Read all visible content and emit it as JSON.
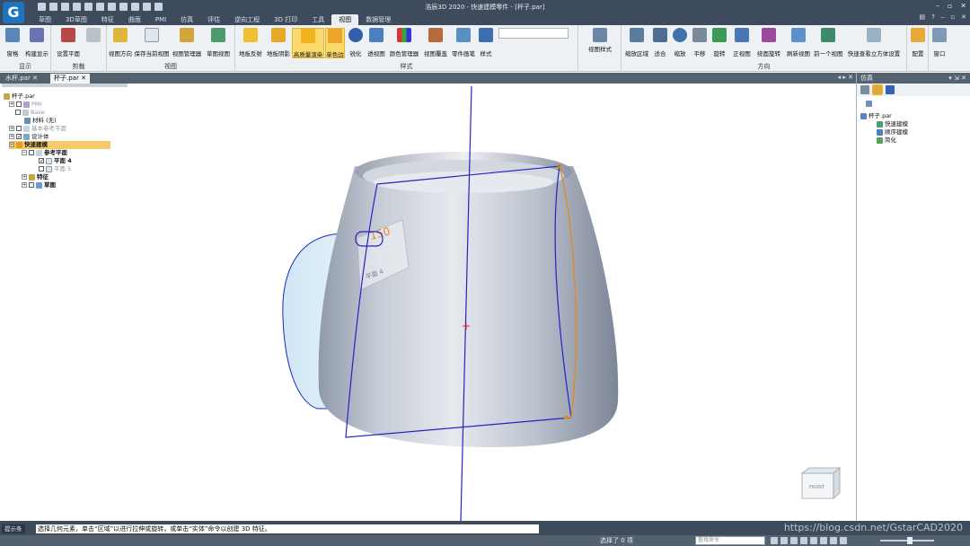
{
  "app": {
    "window_title": "浩辰3D 2020 - 快速建模零件 - [杯子.par]",
    "logo_letter": "G"
  },
  "menu_tabs": [
    "草图",
    "3D草图",
    "特征",
    "曲面",
    "PMI",
    "仿真",
    "评估",
    "逆向工程",
    "3D 打印",
    "工具",
    "视图",
    "数据管理"
  ],
  "active_menu_tab": "视图",
  "ribbon": {
    "groups": [
      "显示",
      "剪裁",
      "视图",
      "样式",
      "方向"
    ],
    "buttons": [
      "窗格",
      "构建显示",
      "设置平面",
      "视图方向",
      "保存当前视图",
      "视图管理器",
      "草图视图",
      "地板反射",
      "地板阴影",
      "高质量渲染",
      "单色边",
      "锐化",
      "透视图",
      "颜色管理器",
      "视图覆盖",
      "零件画笔",
      "样式",
      "视图样式",
      "缩放区域",
      "适合",
      "缩放",
      "平移",
      "旋转",
      "正视图",
      "绕面旋转",
      "刷新视图",
      "前一个视图",
      "快速查看立方体设置",
      "配置",
      "窗口"
    ],
    "active_buttons": [
      "高质量渲染",
      "单色边"
    ]
  },
  "doc_tabs": [
    "水杯.par",
    "杯子.par"
  ],
  "active_doc_tab": "杯子.par",
  "tree": {
    "root": "杯子.par",
    "items": [
      "PMI",
      "Base",
      "材料 (无)",
      "基本参考平面",
      "设计体",
      "快速建模",
      "参考平面",
      "平面 4",
      "平面 5",
      "特征",
      "草图"
    ]
  },
  "viewport": {
    "plane_label": "平面 4",
    "dimension_label": "150",
    "cube_label": "FRONT"
  },
  "right_pane": {
    "title": "仿真",
    "root": "杯子.par",
    "items": [
      "快速建模",
      "顺序建模",
      "简化"
    ]
  },
  "status": {
    "prompt_tag": "提示条",
    "prompt": "选择几何元素，单击“区域”以进行拉伸或旋转，或单击“实体”命令以创建 3D 特征。",
    "selection": "选择了 0 项",
    "search_placeholder": "查找命令",
    "watermark": "https://blog.csdn.net/GstarCAD2020"
  },
  "colors": {
    "title_bg": "#3d4b5c",
    "ribbon_bg": "#eef1f4",
    "active_button": "#fcd96b",
    "sketch_line": "#2323c8",
    "highlight_edge": "#e08a1c"
  }
}
